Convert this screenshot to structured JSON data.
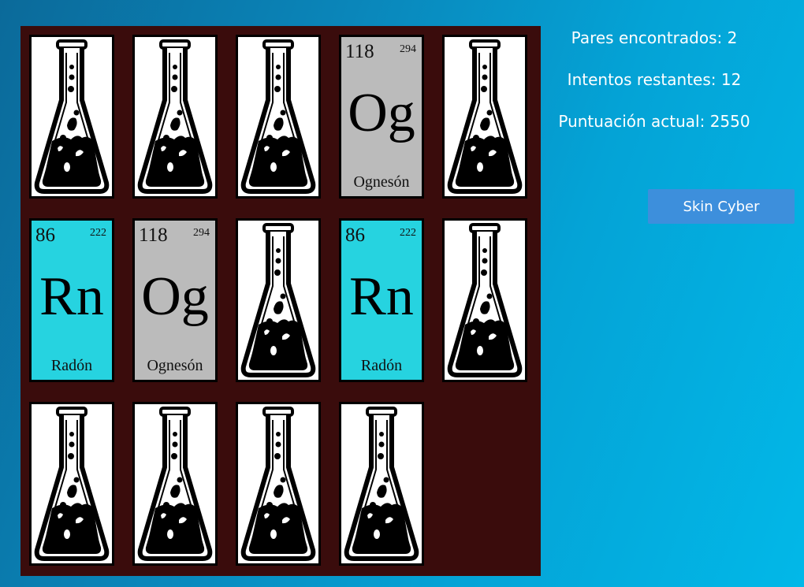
{
  "game": {
    "pairs_found": "Pares encontrados: 2",
    "attempts_left": "Intentos restantes: 12",
    "current_score": "Puntuación actual: 2550",
    "skin_button": "Skin Cyber"
  },
  "colors": {
    "board_bg": "#3a0c0c",
    "radon_card": "#26d3e0",
    "ognesson_card": "#bbbbbb",
    "button": "#3d8fdc"
  },
  "cards": [
    {
      "state": "hidden",
      "icon": "flask-icon"
    },
    {
      "state": "hidden",
      "icon": "flask-icon"
    },
    {
      "state": "hidden",
      "icon": "flask-icon"
    },
    {
      "state": "revealed",
      "number": "118",
      "mass": "294",
      "symbol": "Og",
      "name": "Ognesón",
      "color": "#bbbbbb"
    },
    {
      "state": "hidden",
      "icon": "flask-icon"
    },
    {
      "state": "revealed",
      "number": "86",
      "mass": "222",
      "symbol": "Rn",
      "name": "Radón",
      "color": "#26d3e0"
    },
    {
      "state": "revealed",
      "number": "118",
      "mass": "294",
      "symbol": "Og",
      "name": "Ognesón",
      "color": "#bbbbbb"
    },
    {
      "state": "hidden",
      "icon": "flask-icon"
    },
    {
      "state": "revealed",
      "number": "86",
      "mass": "222",
      "symbol": "Rn",
      "name": "Radón",
      "color": "#26d3e0"
    },
    {
      "state": "hidden",
      "icon": "flask-icon"
    },
    {
      "state": "hidden",
      "icon": "flask-icon"
    },
    {
      "state": "hidden",
      "icon": "flask-icon"
    },
    {
      "state": "hidden",
      "icon": "flask-icon"
    },
    {
      "state": "hidden",
      "icon": "flask-icon"
    }
  ]
}
